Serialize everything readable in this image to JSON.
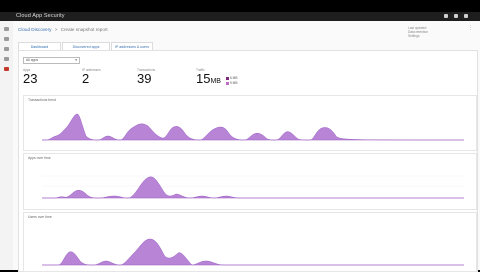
{
  "app": {
    "title": "Cloud App Security"
  },
  "breadcrumb": {
    "root": "Cloud Discovery",
    "separator": ">",
    "current": "Create snapshot report"
  },
  "right_info": {
    "line1": "Last updated",
    "line2": "Data retention",
    "line3": "Settings",
    "menu": "⋮"
  },
  "tabs": [
    {
      "label": "Dashboard",
      "active": true
    },
    {
      "label": "Discovered apps",
      "active": false
    },
    {
      "label": "IP addresses & users",
      "active": false
    }
  ],
  "filter": {
    "label": "All apps",
    "chevron": "▾"
  },
  "stats": [
    {
      "label": "Apps",
      "value": "23",
      "unit": ""
    },
    {
      "label": "IP addresses",
      "value": "2",
      "unit": ""
    },
    {
      "label": "Transactions",
      "value": "39",
      "unit": ""
    },
    {
      "label": "Traffic",
      "value": "15",
      "unit": "MB"
    }
  ],
  "traffic_legend": [
    {
      "label": "6 MB",
      "color": "#7b2a7b"
    },
    {
      "label": "9 MB",
      "color": "#c06bc9"
    }
  ],
  "charts": [
    {
      "title": "Transactions trend",
      "fill": "#b784d6"
    },
    {
      "title": "Apps over time",
      "fill": "#b784d6"
    },
    {
      "title": "Users over time",
      "fill": "#b784d6"
    }
  ],
  "colors": {
    "accent": "#2b6cb0",
    "chart_fill": "#b784d6",
    "chart_stroke": "#9b5cc4"
  }
}
